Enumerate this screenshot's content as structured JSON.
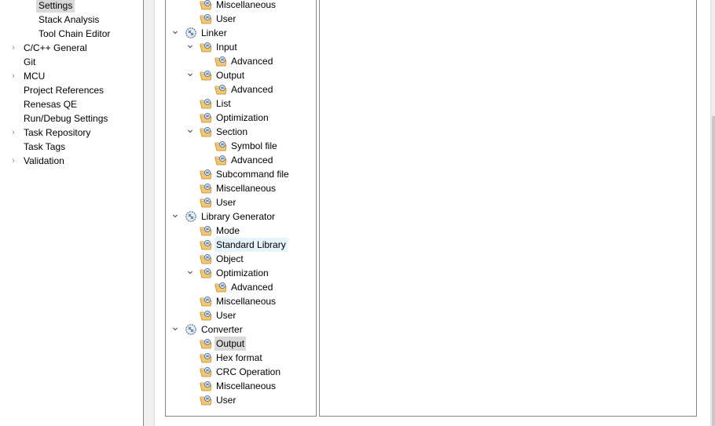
{
  "left_nav": {
    "items": [
      {
        "label": "Settings",
        "level": 2,
        "expandable": false,
        "selected": true
      },
      {
        "label": "Stack Analysis",
        "level": 2,
        "expandable": false
      },
      {
        "label": "Tool Chain Editor",
        "level": 2,
        "expandable": false
      },
      {
        "label": "C/C++ General",
        "level": 1,
        "expandable": true
      },
      {
        "label": "Git",
        "level": 1,
        "expandable": false
      },
      {
        "label": "MCU",
        "level": 1,
        "expandable": true
      },
      {
        "label": "Project References",
        "level": 1,
        "expandable": false
      },
      {
        "label": "Renesas QE",
        "level": 1,
        "expandable": false
      },
      {
        "label": "Run/Debug Settings",
        "level": 1,
        "expandable": false
      },
      {
        "label": "Task Repository",
        "level": 1,
        "expandable": true
      },
      {
        "label": "Task Tags",
        "level": 1,
        "expandable": false
      },
      {
        "label": "Validation",
        "level": 1,
        "expandable": true
      }
    ]
  },
  "tool_tree": {
    "items": [
      {
        "label": "Miscellaneous",
        "level": 1,
        "icon": "folder-tool-icon"
      },
      {
        "label": "User",
        "level": 1,
        "icon": "folder-tool-icon"
      },
      {
        "label": "Linker",
        "level": 0,
        "icon": "tool-icon",
        "expanded": true
      },
      {
        "label": "Input",
        "level": 1,
        "icon": "folder-tool-icon",
        "expanded": true
      },
      {
        "label": "Advanced",
        "level": 2,
        "icon": "folder-tool-icon"
      },
      {
        "label": "Output",
        "level": 1,
        "icon": "folder-tool-icon",
        "expanded": true
      },
      {
        "label": "Advanced",
        "level": 2,
        "icon": "folder-tool-icon"
      },
      {
        "label": "List",
        "level": 1,
        "icon": "folder-tool-icon"
      },
      {
        "label": "Optimization",
        "level": 1,
        "icon": "folder-tool-icon"
      },
      {
        "label": "Section",
        "level": 1,
        "icon": "folder-tool-icon",
        "expanded": true
      },
      {
        "label": "Symbol file",
        "level": 2,
        "icon": "folder-tool-icon"
      },
      {
        "label": "Advanced",
        "level": 2,
        "icon": "folder-tool-icon"
      },
      {
        "label": "Subcommand file",
        "level": 1,
        "icon": "folder-tool-icon"
      },
      {
        "label": "Miscellaneous",
        "level": 1,
        "icon": "folder-tool-icon"
      },
      {
        "label": "User",
        "level": 1,
        "icon": "folder-tool-icon"
      },
      {
        "label": "Library Generator",
        "level": 0,
        "icon": "tool-icon",
        "expanded": true
      },
      {
        "label": "Mode",
        "level": 1,
        "icon": "folder-tool-icon"
      },
      {
        "label": "Standard Library",
        "level": 1,
        "icon": "folder-tool-icon",
        "hover": true
      },
      {
        "label": "Object",
        "level": 1,
        "icon": "folder-tool-icon"
      },
      {
        "label": "Optimization",
        "level": 1,
        "icon": "folder-tool-icon",
        "expanded": true
      },
      {
        "label": "Advanced",
        "level": 2,
        "icon": "folder-tool-icon"
      },
      {
        "label": "Miscellaneous",
        "level": 1,
        "icon": "folder-tool-icon"
      },
      {
        "label": "User",
        "level": 1,
        "icon": "folder-tool-icon"
      },
      {
        "label": "Converter",
        "level": 0,
        "icon": "tool-icon",
        "expanded": true
      },
      {
        "label": "Output",
        "level": 1,
        "icon": "folder-tool-icon",
        "selected": true
      },
      {
        "label": "Hex format",
        "level": 1,
        "icon": "folder-tool-icon"
      },
      {
        "label": "CRC Operation",
        "level": 1,
        "icon": "folder-tool-icon"
      },
      {
        "label": "Miscellaneous",
        "level": 1,
        "icon": "folder-tool-icon"
      },
      {
        "label": "User",
        "level": 1,
        "icon": "folder-tool-icon"
      }
    ]
  },
  "colors": {
    "selection": "#d9d9d9",
    "hover": "#e5f3fb",
    "border": "#828790"
  }
}
